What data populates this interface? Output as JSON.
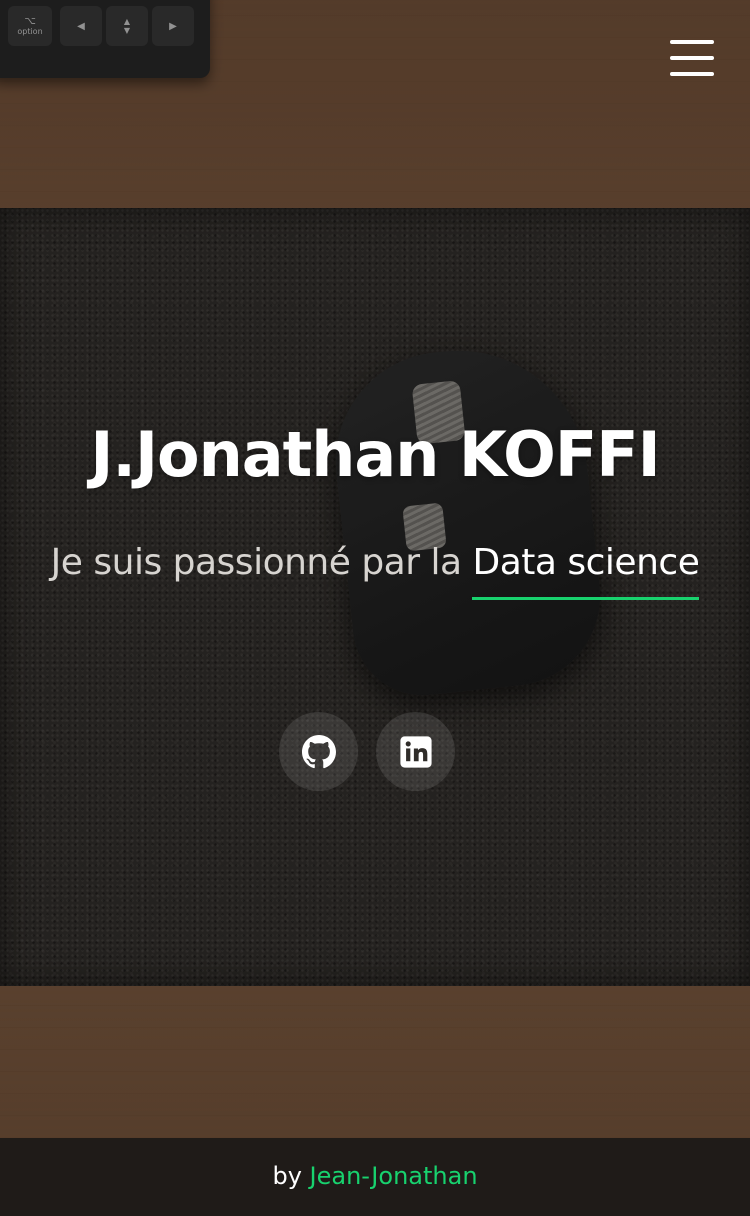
{
  "header": {
    "menu_icon": "hamburger-menu-icon"
  },
  "background": {
    "keyboard_keys": [
      "⌥\noption",
      "◀",
      "▲▼",
      "▶"
    ]
  },
  "hero": {
    "name": "J.Jonathan KOFFI",
    "tagline_prefix": "Je suis passionné par la ",
    "tagline_typed": "Data science",
    "accent_color": "#18d26e"
  },
  "socials": [
    {
      "icon": "github-icon"
    },
    {
      "icon": "linkedin-icon"
    }
  ],
  "footer": {
    "by_label": "by",
    "author_link": "Jean-Jonathan"
  }
}
